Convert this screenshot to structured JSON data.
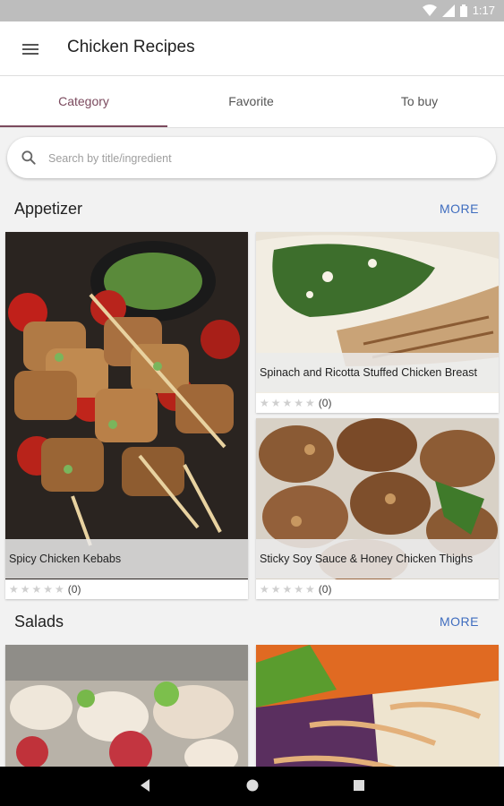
{
  "status": {
    "time": "1:17"
  },
  "app": {
    "title": "Chicken Recipes"
  },
  "tabs": [
    {
      "label": "Category"
    },
    {
      "label": "Favorite"
    },
    {
      "label": "To buy"
    }
  ],
  "search": {
    "placeholder": "Search by title/ingredient"
  },
  "sections": [
    {
      "title": "Appetizer",
      "more": "MORE",
      "recipes": [
        {
          "title": "Spicy Chicken Kebabs",
          "count": "(0)"
        },
        {
          "title": "Spinach and Ricotta Stuffed Chicken Breast",
          "count": "(0)"
        },
        {
          "title": "Sticky Soy Sauce & Honey Chicken Thighs",
          "count": "(0)"
        }
      ]
    },
    {
      "title": "Salads",
      "more": "MORE",
      "recipes": [
        {
          "title": "",
          "count": ""
        },
        {
          "title": "",
          "count": ""
        }
      ]
    }
  ],
  "stars": "★★★★★",
  "colors": {
    "accent": "#7b4a5e",
    "link": "#3f6dbf"
  }
}
